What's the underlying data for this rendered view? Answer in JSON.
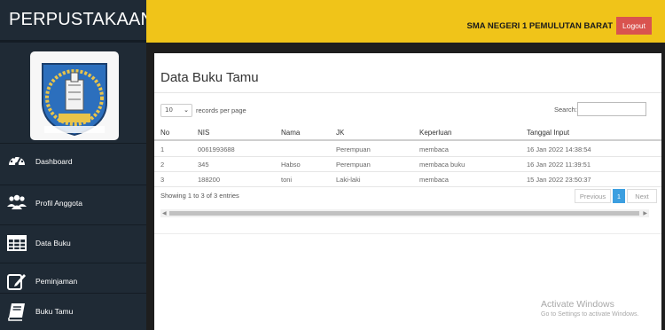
{
  "brand": {
    "title": "PERPUSTAKAAN"
  },
  "topbar": {
    "school": "SMA NEGERI 1 PEMULUTAN BARAT",
    "logout_label": "Logout"
  },
  "sidebar": {
    "items": [
      {
        "label": "Dashboard",
        "icon": "dashboard-gauge-icon"
      },
      {
        "label": "Profil Anggota",
        "icon": "users-icon"
      },
      {
        "label": "Data Buku",
        "icon": "table-grid-icon"
      },
      {
        "label": "Peminjaman",
        "icon": "edit-icon"
      },
      {
        "label": "Buku Tamu",
        "icon": "book-icon"
      }
    ]
  },
  "main": {
    "title": "Data Buku Tamu",
    "page_length": "10",
    "records_label": "records per page",
    "search_label": "Search:",
    "search_value": "",
    "columns": [
      "No",
      "NIS",
      "Nama",
      "JK",
      "Keperluan",
      "Tanggal Input"
    ],
    "rows": [
      [
        "1",
        "0061993688",
        "",
        "Perempuan",
        "membaca",
        "16 Jan 2022 14:38:54"
      ],
      [
        "2",
        "345",
        "Habso",
        "Perempuan",
        "membaca buku",
        "16 Jan 2022 11:39:51"
      ],
      [
        "3",
        "188200",
        "toni",
        "Laki-laki",
        "membaca",
        "15 Jan 2022 23:50:37"
      ]
    ],
    "info": "Showing 1 to 3 of 3 entries",
    "pagination": {
      "previous": "Previous",
      "current": "1",
      "next": "Next"
    }
  },
  "watermark": {
    "line1": "Activate Windows",
    "line2": "Go to Settings to activate Windows."
  },
  "colors": {
    "topbar": "#f0c419",
    "sidebar": "#1f2a35",
    "logout": "#d9534f",
    "page_active": "#3c9fe0"
  }
}
